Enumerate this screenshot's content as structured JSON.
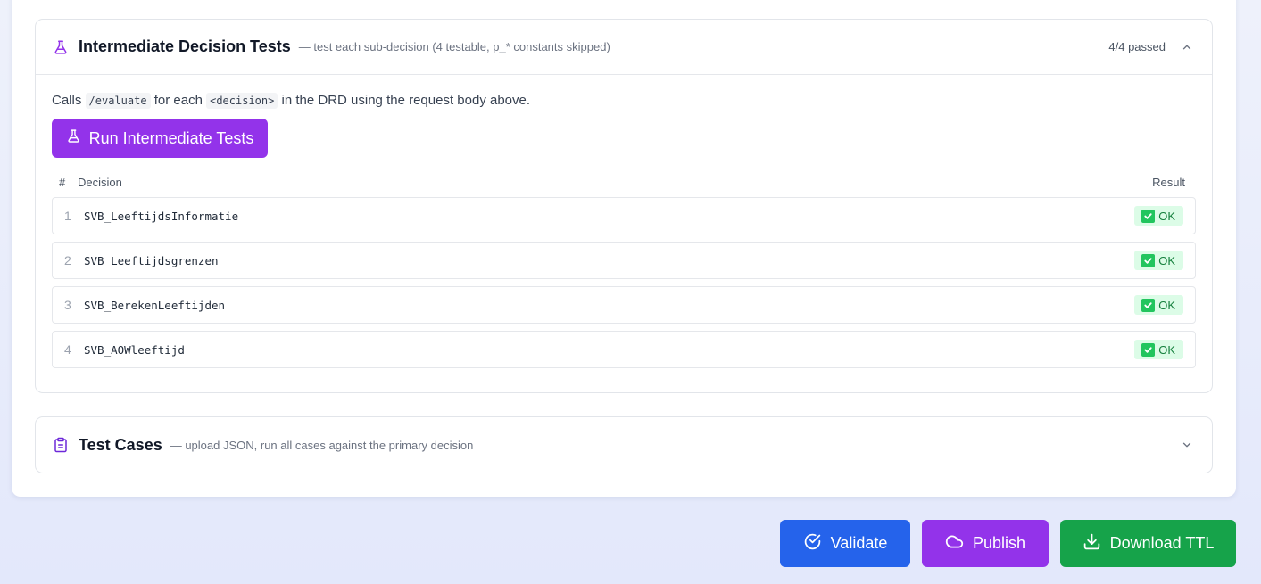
{
  "intermediate": {
    "title": "Intermediate Decision Tests",
    "subtitle": "— test each sub-decision (4 testable, p_* constants skipped)",
    "status": "4/4 passed",
    "intro_prefix": "Calls",
    "intro_code1": "/evaluate",
    "intro_mid": "for each",
    "intro_code2": "<decision>",
    "intro_suffix": "in the DRD using the request body above.",
    "run_label": "Run Intermediate Tests",
    "columns": {
      "num": "#",
      "decision": "Decision",
      "result": "Result"
    },
    "rows": [
      {
        "num": "1",
        "name": "SVB_LeeftijdsInformatie",
        "result": "OK"
      },
      {
        "num": "2",
        "name": "SVB_Leeftijdsgrenzen",
        "result": "OK"
      },
      {
        "num": "3",
        "name": "SVB_BerekenLeeftijden",
        "result": "OK"
      },
      {
        "num": "4",
        "name": "SVB_AOWleeftijd",
        "result": "OK"
      }
    ]
  },
  "test_cases": {
    "title": "Test Cases",
    "subtitle": "— upload JSON, run all cases against the primary decision"
  },
  "actions": {
    "validate": "Validate",
    "publish": "Publish",
    "download": "Download TTL"
  },
  "icons": {
    "flask": "flask-icon",
    "clipboard": "clipboard-icon",
    "check_circle": "check-circle-icon",
    "cloud": "cloud-icon",
    "download": "download-icon"
  },
  "colors": {
    "purple": "#9333ea",
    "blue": "#2563eb",
    "green": "#16a34a",
    "ok_bg": "#dcfce7",
    "ok_text": "#15803d"
  }
}
